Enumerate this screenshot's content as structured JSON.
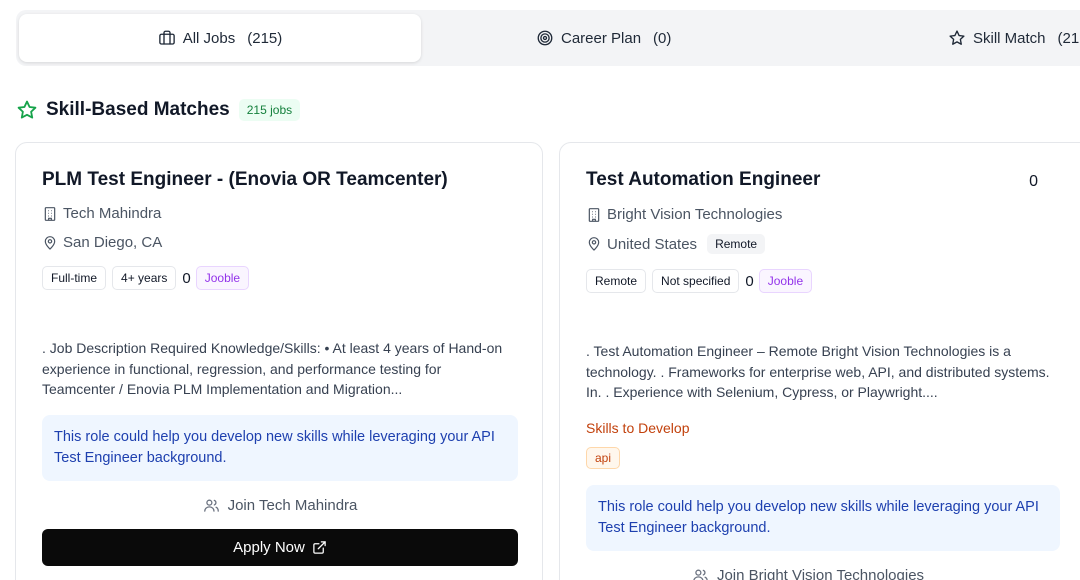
{
  "tabs": [
    {
      "label": "All Jobs",
      "count": "(215)",
      "icon": "briefcase-icon"
    },
    {
      "label": "Career Plan",
      "count": "(0)",
      "icon": "target-icon"
    },
    {
      "label": "Skill Match",
      "count": "(21",
      "icon": "star-icon"
    }
  ],
  "section": {
    "title": "Skill-Based Matches",
    "badge": "215 jobs",
    "icon": "star-icon"
  },
  "jobs": [
    {
      "title": "PLM Test Engineer - (Enovia OR Teamcenter)",
      "company": "Tech Mahindra",
      "location": "San Diego, CA",
      "chips": [
        "Full-time",
        "4+ years"
      ],
      "zero": "0",
      "source": "Jooble",
      "description": ". Job Description Required Knowledge/Skills: • At least 4 years of Hand-on experience in functional, regression, and performance testing for Teamcenter / Enovia PLM Implementation and Migration...",
      "info": "This role could help you develop new skills while leveraging your API Test Engineer background.",
      "join": "Join Tech Mahindra",
      "apply": "Apply Now"
    },
    {
      "title": "Test Automation Engineer",
      "score": "0",
      "company": "Bright Vision Technologies",
      "location": "United States",
      "location_chip": "Remote",
      "chips": [
        "Remote",
        "Not specified"
      ],
      "zero": "0",
      "source": "Jooble",
      "description": ". Test Automation Engineer – Remote Bright Vision Technologies is a technology. . Frameworks for enterprise web, API, and distributed systems. In. . Experience with Selenium, Cypress, or Playwright....",
      "skills_label": "Skills to Develop",
      "skills": [
        "api"
      ],
      "info": "This role could help you develop new skills while leveraging your API Test Engineer background.",
      "join": "Join Bright Vision Technologies"
    }
  ],
  "colors": {
    "accent_green": "#15803d",
    "purple": "#9333ea",
    "orange": "#c2410c",
    "info_blue": "#1e40af",
    "button_black": "#0a0a0a"
  }
}
